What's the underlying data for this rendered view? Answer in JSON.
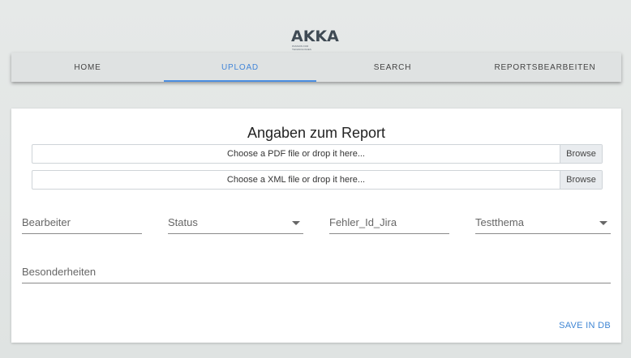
{
  "logo": {
    "text": "AKKA",
    "tagline": "PASSION FOR TECHNOLOGIES"
  },
  "nav": {
    "items": [
      {
        "label": "HOME"
      },
      {
        "label": "UPLOAD"
      },
      {
        "label": "SEARCH"
      },
      {
        "label": "REPORTSBEARBEITEN"
      }
    ],
    "active": "UPLOAD"
  },
  "form": {
    "title": "Angaben zum Report",
    "pdf_upload": {
      "placeholder": "Choose a PDF file or drop it here...",
      "button": "Browse"
    },
    "xml_upload": {
      "placeholder": "Choose a XML file or drop it here...",
      "button": "Browse"
    },
    "fields": {
      "bearbeiter": "Bearbeiter",
      "status": "Status",
      "fehler_id_jira": "Fehler_Id_Jira",
      "testthema": "Testthema",
      "besonderheiten": "Besonderheiten"
    },
    "save_label": "SAVE IN DB"
  },
  "colors": {
    "accent": "#4285d8",
    "background": "#e3e6e5",
    "card": "#ffffff"
  }
}
